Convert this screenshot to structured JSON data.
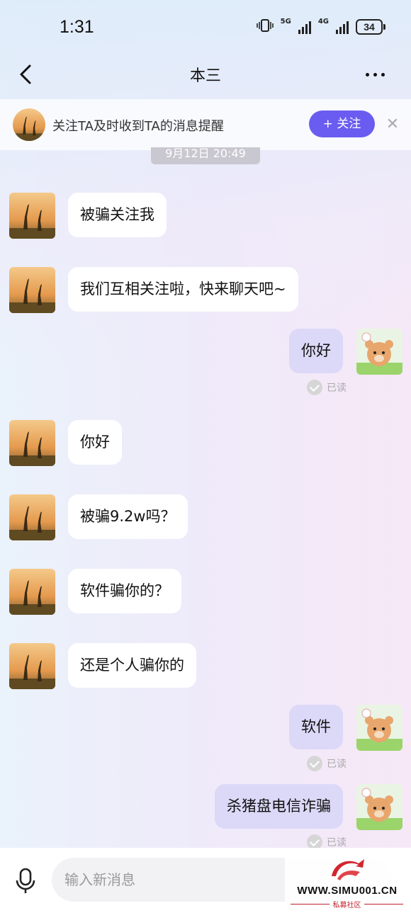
{
  "status_bar": {
    "time": "1:31",
    "network_1": "5G",
    "network_2": "4G",
    "battery": "34"
  },
  "header": {
    "title": "本三",
    "back_icon": "chevron-left-icon",
    "more_icon": "more-horizontal-icon"
  },
  "follow_banner": {
    "text": "关注TA及时收到TA的消息提醒",
    "button_label": "+ 关注",
    "close_label": "✕",
    "accent": "#6a5cf0"
  },
  "timestamp": "9月12日 20:49",
  "messages": [
    {
      "side": "in",
      "text": "被骗关注我"
    },
    {
      "side": "in",
      "text": "我们互相关注啦，快来聊天吧~"
    },
    {
      "side": "out",
      "text": "你好",
      "read": "已读"
    },
    {
      "side": "in",
      "text": "你好"
    },
    {
      "side": "in",
      "text": "被骗9.2w吗？"
    },
    {
      "side": "in",
      "text": "软件骗你的？"
    },
    {
      "side": "in",
      "text": "还是个人骗你的"
    },
    {
      "side": "out",
      "text": "软件",
      "read": "已读"
    },
    {
      "side": "out",
      "text": "杀猪盘电信诈骗",
      "read": "已读"
    }
  ],
  "input_bar": {
    "placeholder": "输入新消息",
    "mic_icon": "microphone-icon"
  },
  "watermark": {
    "site": "WWW.SIMU001.CN",
    "sub": "私募社区"
  },
  "colors": {
    "outgoing_bubble": "#dcd8f7",
    "incoming_bubble": "#ffffff"
  }
}
